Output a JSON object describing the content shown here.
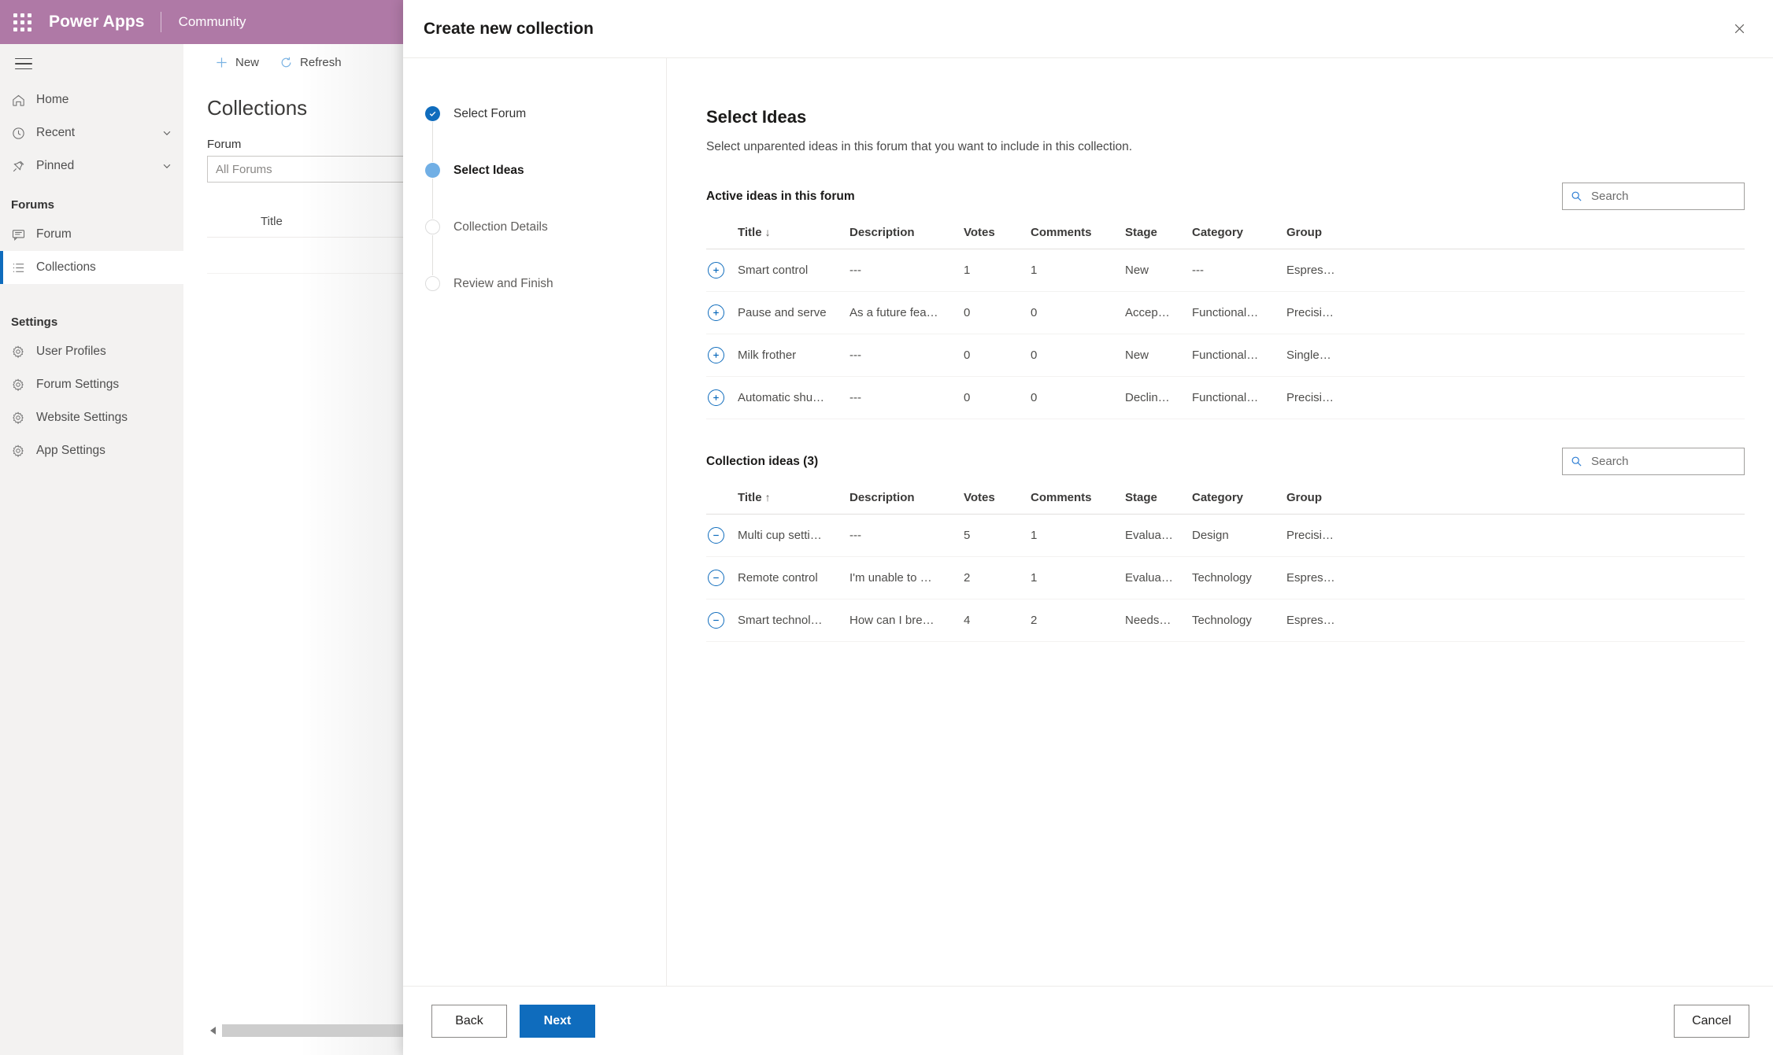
{
  "topbar": {
    "waffle_icon": "app-launcher-icon",
    "brand": "Power Apps",
    "app_name": "Community"
  },
  "sidebar": {
    "hamburger_icon": "hamburger-menu-icon",
    "items": [
      {
        "label": "Home",
        "icon": "home-icon",
        "chevron": false
      },
      {
        "label": "Recent",
        "icon": "clock-icon",
        "chevron": true
      },
      {
        "label": "Pinned",
        "icon": "pin-icon",
        "chevron": true
      }
    ],
    "group_forums": "Forums",
    "forum_items": [
      {
        "label": "Forum",
        "icon": "forum-icon",
        "active": false
      },
      {
        "label": "Collections",
        "icon": "list-icon",
        "active": true
      }
    ],
    "group_settings": "Settings",
    "settings_items": [
      {
        "label": "User Profiles",
        "icon": "gear-icon"
      },
      {
        "label": "Forum Settings",
        "icon": "gear-icon"
      },
      {
        "label": "Website Settings",
        "icon": "gear-icon"
      },
      {
        "label": "App Settings",
        "icon": "gear-icon"
      }
    ]
  },
  "background_page": {
    "commands": [
      {
        "label": "New",
        "icon": "plus-icon"
      },
      {
        "label": "Refresh",
        "icon": "refresh-icon"
      }
    ],
    "title": "Collections",
    "forum_label": "Forum",
    "forum_value": "All Forums",
    "table_header_title": "Title"
  },
  "dialog": {
    "title": "Create new collection",
    "close_icon": "close-icon",
    "steps": [
      {
        "label": "Select Forum",
        "state": "done"
      },
      {
        "label": "Select Ideas",
        "state": "current"
      },
      {
        "label": "Collection Details",
        "state": "todo"
      },
      {
        "label": "Review and Finish",
        "state": "todo"
      }
    ],
    "pane": {
      "heading": "Select Ideas",
      "subheading": "Select unparented ideas in this forum that you want to include in this collection.",
      "active_section": {
        "title": "Active ideas in this forum",
        "search_placeholder": "Search",
        "search_value": "",
        "search_icon": "search-icon",
        "sort_column": "Title",
        "sort_direction": "↓",
        "row_action_icon": "add-circle-icon",
        "columns": [
          "Title",
          "Description",
          "Votes",
          "Comments",
          "Stage",
          "Category",
          "Group"
        ],
        "rows": [
          {
            "title": "Smart control",
            "description": "---",
            "votes": "1",
            "comments": "1",
            "stage": "New",
            "category": "---",
            "group": "Espres…"
          },
          {
            "title": "Pause and serve",
            "description": "As a future fea…",
            "votes": "0",
            "comments": "0",
            "stage": "Accep…",
            "category": "Functional…",
            "group": "Precisi…"
          },
          {
            "title": "Milk frother",
            "description": "---",
            "votes": "0",
            "comments": "0",
            "stage": "New",
            "category": "Functional…",
            "group": "Single…"
          },
          {
            "title": "Automatic shu…",
            "description": "---",
            "votes": "0",
            "comments": "0",
            "stage": "Declin…",
            "category": "Functional…",
            "group": "Precisi…"
          }
        ]
      },
      "collection_section": {
        "title": "Collection ideas (3)",
        "search_placeholder": "Search",
        "search_value": "",
        "search_icon": "search-icon",
        "sort_column": "Title",
        "sort_direction": "↑",
        "row_action_icon": "remove-circle-icon",
        "columns": [
          "Title",
          "Description",
          "Votes",
          "Comments",
          "Stage",
          "Category",
          "Group"
        ],
        "rows": [
          {
            "title": "Multi cup setti…",
            "description": "---",
            "votes": "5",
            "comments": "1",
            "stage": "Evalua…",
            "category": "Design",
            "group": "Precisi…"
          },
          {
            "title": "Remote control",
            "description": "I'm unable to …",
            "votes": "2",
            "comments": "1",
            "stage": "Evalua…",
            "category": "Technology",
            "group": "Espres…"
          },
          {
            "title": "Smart technol…",
            "description": "How can I bre…",
            "votes": "4",
            "comments": "2",
            "stage": "Needs…",
            "category": "Technology",
            "group": "Espres…"
          }
        ]
      }
    },
    "footer": {
      "back": "Back",
      "next": "Next",
      "cancel": "Cancel"
    }
  },
  "colors": {
    "brand_bar": "#af79a6",
    "accent_blue": "#0f6cbd",
    "step_current": "#71afe5",
    "nav_active_indicator": "#0f6cbd"
  }
}
